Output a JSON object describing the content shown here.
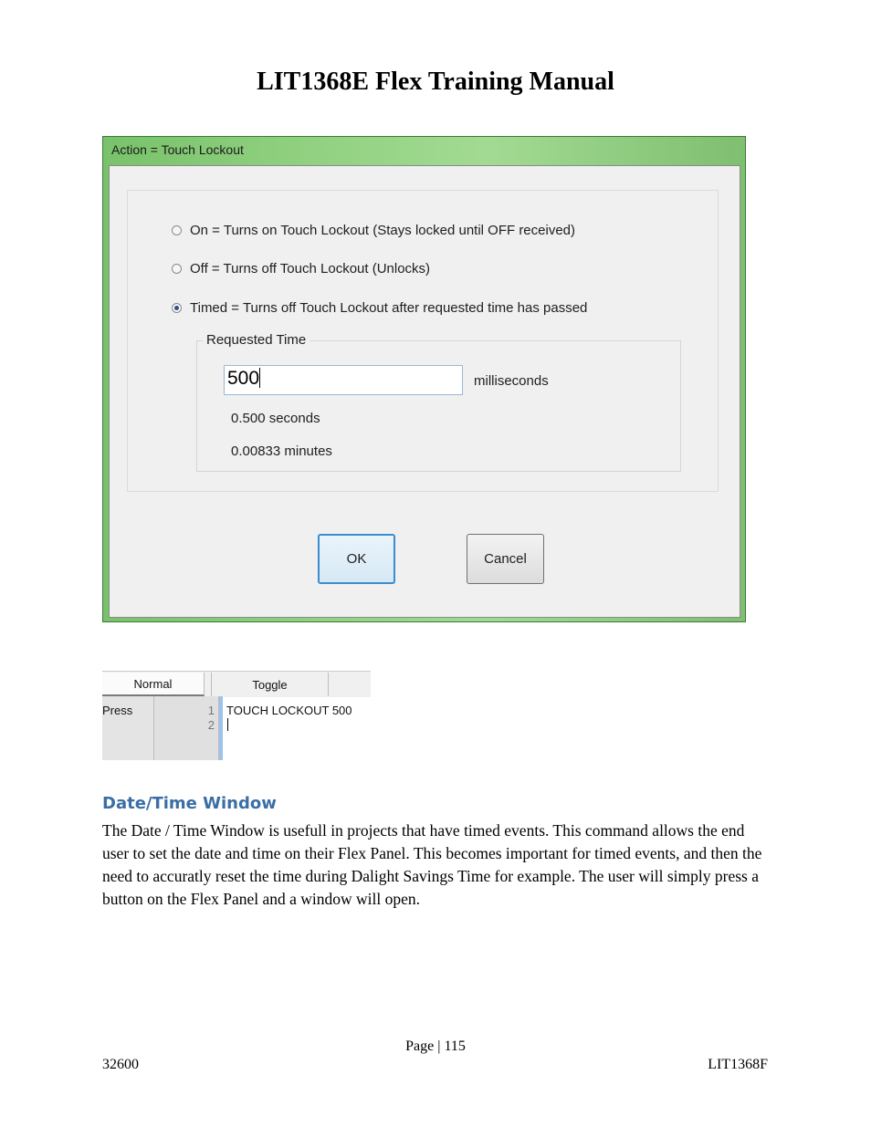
{
  "document": {
    "title": "LIT1368E Flex Training Manual",
    "section_heading": "Date/Time Window",
    "paragraph": "The Date / Time Window is usefull in projects that have timed events. This command allows the end user to set the date and time on their Flex Panel. This becomes important for timed events, and then the need to accuratly reset the time during Dalight Savings Time for example. The user will simply press a button on the Flex Panel and a window will open."
  },
  "dialog": {
    "title": "Action = Touch Lockout",
    "options": [
      {
        "label": "On = Turns on Touch Lockout (Stays locked until OFF received)",
        "checked": false
      },
      {
        "label": "Off = Turns off Touch Lockout (Unlocks)",
        "checked": false
      },
      {
        "label": "Timed = Turns off Touch Lockout after requested time has passed",
        "checked": true
      }
    ],
    "requested_time": {
      "legend": "Requested Time",
      "value": "500",
      "unit": "milliseconds",
      "seconds_text": "0.500 seconds",
      "minutes_text": "0.00833 minutes"
    },
    "ok_label": "OK",
    "cancel_label": "Cancel"
  },
  "grid": {
    "columns": [
      "Normal",
      "Toggle"
    ],
    "row_label": "Press",
    "line_numbers": [
      "1",
      "2"
    ],
    "lines": [
      "TOUCH LOCKOUT 500",
      ""
    ]
  },
  "footer": {
    "page": "Page | 115",
    "left": "32600",
    "right": "LIT1368F"
  }
}
